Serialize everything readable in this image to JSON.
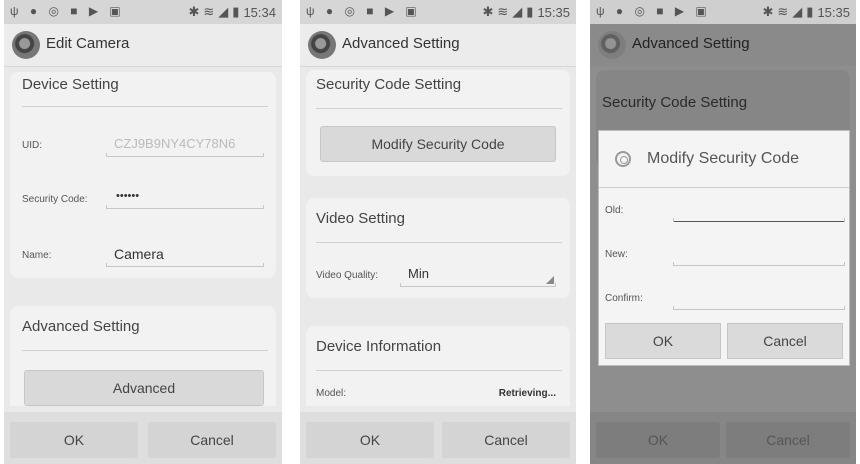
{
  "status": {
    "time1": "15:34",
    "time2": "15:35",
    "time3": "15:35"
  },
  "screen1": {
    "title": "Edit Camera",
    "device_setting": "Device Setting",
    "uid_label": "UID:",
    "uid_value": "CZJ9B9NY4CY78N6",
    "code_label": "Security Code:",
    "code_value": "••••••",
    "name_label": "Name:",
    "name_value": "Camera",
    "advanced_setting": "Advanced Setting",
    "advanced_button": "Advanced",
    "ok": "OK",
    "cancel": "Cancel"
  },
  "screen2": {
    "title": "Advanced Setting",
    "security_code_setting": "Security Code Setting",
    "modify_button": "Modify Security Code",
    "video_setting": "Video Setting",
    "quality_label": "Video Quality:",
    "quality_value": "Min",
    "device_information": "Device Information",
    "model_label": "Model:",
    "model_value": "Retrieving...",
    "ok": "OK",
    "cancel": "Cancel"
  },
  "screen3": {
    "title": "Advanced Setting",
    "security_code_setting": "Security Code Setting",
    "dialog_title": "Modify Security Code",
    "old_label": "Old:",
    "new_label": "New:",
    "confirm_label": "Confirm:",
    "ok": "OK",
    "cancel": "Cancel",
    "bg_ok": "OK",
    "bg_cancel": "Cancel"
  }
}
